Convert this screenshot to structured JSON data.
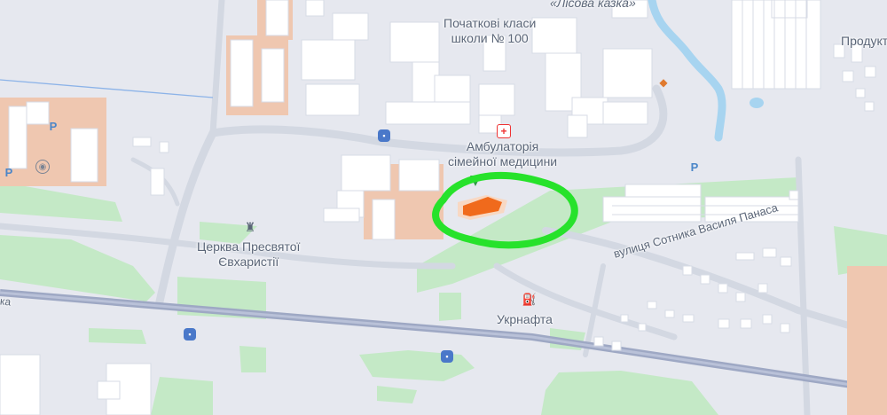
{
  "map": {
    "labels": {
      "school_line1": "Початкові класи",
      "school_line2": "школи № 100",
      "kazka": "«Лісова казка»",
      "produkt": "Продукт",
      "clinic_line1": "Амбулаторія",
      "clinic_line2": "сімейної медицини",
      "church_line1": "Церква Пресвятої",
      "church_line2": "Євхаристії",
      "gas_station": "Укрнафта",
      "street_sotnyka": "вулиця Сотника Василя Панаса",
      "street_left_edge": "ка"
    },
    "icons": {
      "bus": "bus-stop-icon",
      "parking": "parking-icon",
      "clinic": "medical-cross-icon",
      "church": "church-icon",
      "gas": "fuel-pump-icon",
      "viewpoint": "eye-icon",
      "shop": "shop-icon"
    },
    "colors": {
      "background": "#e6e8ef",
      "park": "#c4e9c6",
      "building": "#ffffff",
      "residential": "#efc7b0",
      "water": "#a7d4f0",
      "railway": "#9ea8c4",
      "road": "#d3d8e2",
      "highlight_circle": "#27e22b",
      "target_building": "#f06a1c"
    }
  }
}
